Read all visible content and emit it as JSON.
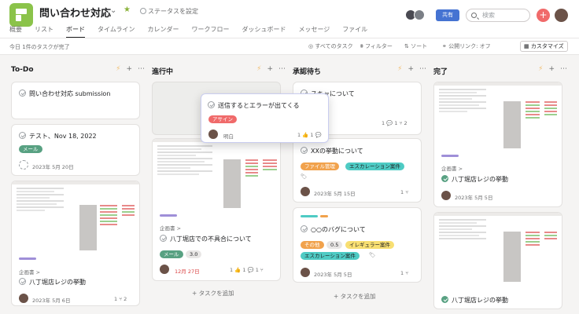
{
  "header": {
    "project_title": "問い合わせ対応",
    "status_label": "ステータスを設定",
    "share_label": "共有",
    "search_placeholder": "検索",
    "plus_symbol": "+"
  },
  "tabs": [
    "概要",
    "リスト",
    "ボード",
    "タイムライン",
    "カレンダー",
    "ワークフロー",
    "ダッシュボード",
    "メッセージ",
    "ファイル"
  ],
  "active_tab": "ボード",
  "toolbar": {
    "completed_note": "今日 1件のタスクが完了",
    "all_tasks": "すべてのタスク",
    "filter": "フィルター",
    "sort": "ソート",
    "public_link": "公開リンク: オフ",
    "customize": "カスタマイズ"
  },
  "columns": [
    {
      "title": "To-Do",
      "add_task": ""
    },
    {
      "title": "進行中",
      "add_task": "+ タスクを追加"
    },
    {
      "title": "承認待ち",
      "add_task": "+ タスクを追加"
    },
    {
      "title": "完了",
      "add_task": ""
    }
  ],
  "cards": {
    "todo1": {
      "title": "問い合わせ対応 submission"
    },
    "todo2": {
      "title": "テスト、Nov 18, 2022",
      "tag": "メール",
      "date": "2023年 5月 20日"
    },
    "todo3": {
      "project": "企画書 >",
      "title": "八丁堀店レジの挙動",
      "date": "2023年 5月 6日",
      "subtasks": "1 ⑂ 2"
    },
    "prog2": {
      "project": "企画書 >",
      "title": "八丁堀店での不具合について",
      "tag": "メール",
      "count": "3.0",
      "date": "12月 27日",
      "stats": "1 👍 1 💬 1 ⑂"
    },
    "lifted": {
      "title": "送信するとエラーが出てくる",
      "tag": "アサイン",
      "assignee": "明白",
      "stats": "1 👍 1 💬"
    },
    "appr1": {
      "title": "スキャについて",
      "stats": "1 💬 1 ⑂ 2"
    },
    "appr2": {
      "title": "XXの挙動について",
      "tag1": "ファイル管理",
      "tag2": "エスカレーション案件",
      "date": "2023年 5月 15日",
      "stats": "1 ⑂"
    },
    "appr3": {
      "title": "○○のバグについて",
      "tag1": "その他",
      "tag2": "0.5",
      "tag3": "イレギュラー案件",
      "tag4": "エスカレーション案件",
      "date": "2023年 5月 5日",
      "stats": "1 ⑂"
    },
    "done1": {
      "project": "企画書 >",
      "title": "八丁堀店レジの挙動",
      "date": "2023年 5月 5日"
    },
    "done2": {
      "title": "八丁堀店レジの挙動"
    }
  },
  "colors": {
    "accent_green": "#8bc34a",
    "tag_mail": "#58a182",
    "tag_red": "#f06a6a",
    "tag_orange": "#f1a24c",
    "tag_teal": "#4ecbc4",
    "tag_yellow": "#f8df72",
    "share_blue": "#4573d2"
  }
}
